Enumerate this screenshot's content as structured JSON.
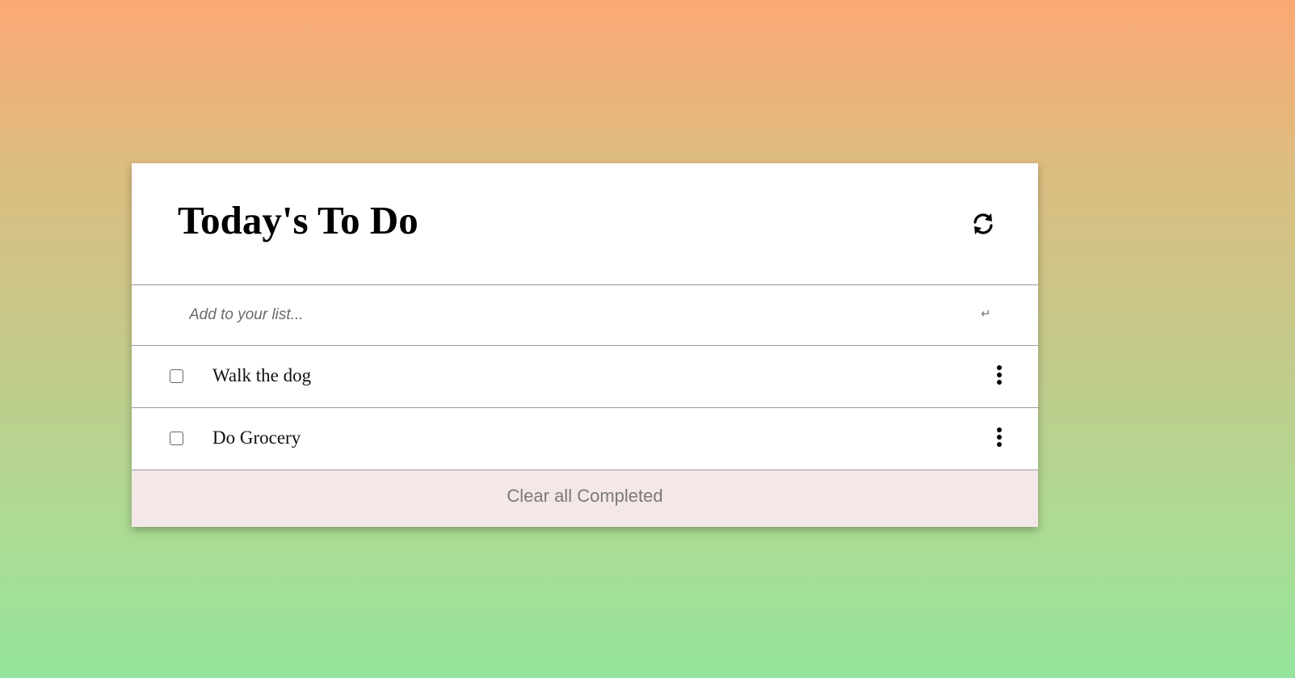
{
  "header": {
    "title": "Today's To Do",
    "refresh_icon": "refresh-icon"
  },
  "add": {
    "placeholder": "Add to your list...",
    "value": "",
    "enter_icon": "↵"
  },
  "todos": [
    {
      "label": "Walk the dog",
      "completed": false
    },
    {
      "label": "Do Grocery",
      "completed": false
    }
  ],
  "footer": {
    "clear_label": "Clear all Completed"
  },
  "colors": {
    "gradient_top": "#fca874",
    "gradient_bottom": "#94e49d",
    "card_background": "#ffffff",
    "footer_background": "#f4e7e7",
    "footer_text": "#7a7a7a"
  }
}
